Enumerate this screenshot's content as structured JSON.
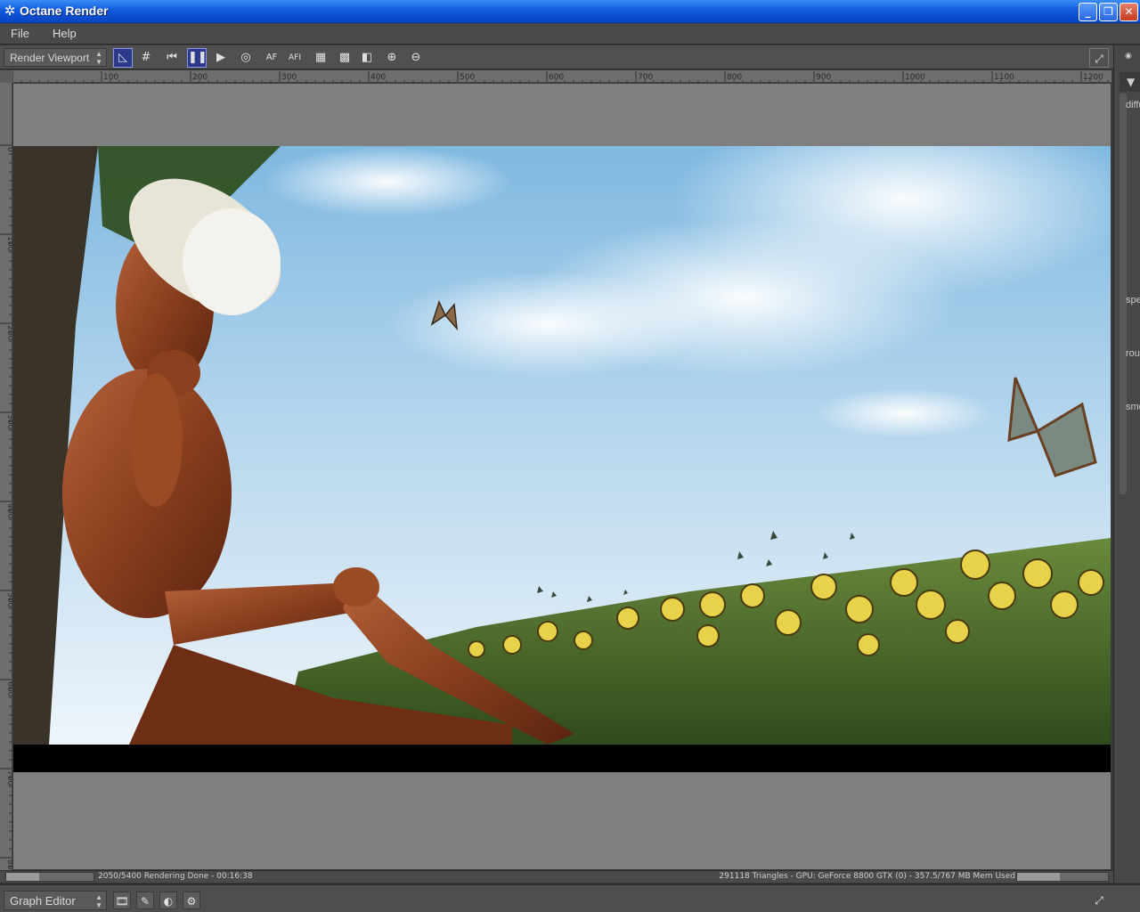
{
  "window": {
    "title": "Octane Render",
    "controls": {
      "minimize": "_",
      "maximize": "❐",
      "close": "✕"
    }
  },
  "menu": {
    "items": [
      "File",
      "Help"
    ]
  },
  "toolbar": {
    "viewport_select": "Render Viewport",
    "buttons": [
      {
        "name": "pick-focus-button",
        "glyph": "◺",
        "active": true
      },
      {
        "name": "grid-button",
        "glyph": "#",
        "active": false
      },
      {
        "name": "restart-render-button",
        "glyph": "⏮",
        "active": false
      },
      {
        "name": "pause-render-button",
        "glyph": "❚❚",
        "active": true
      },
      {
        "name": "play-render-button",
        "glyph": "▶",
        "active": false
      },
      {
        "name": "recenter-view-button",
        "glyph": "◎",
        "active": false
      },
      {
        "name": "auto-focus-button",
        "glyph": "AF",
        "active": false
      },
      {
        "name": "auto-focus-interactive-button",
        "glyph": "AFI",
        "active": false
      },
      {
        "name": "alpha-channel-button",
        "glyph": "▦",
        "active": false
      },
      {
        "name": "checker-background-button",
        "glyph": "▩",
        "active": false
      },
      {
        "name": "region-render-button",
        "glyph": "◧",
        "active": false
      },
      {
        "name": "zoom-in-button",
        "glyph": "⊕",
        "active": false
      },
      {
        "name": "zoom-out-button",
        "glyph": "⊖",
        "active": false
      }
    ],
    "fullscreen_glyph": "⤢"
  },
  "ruler": {
    "h_labels": [
      "100",
      "200",
      "300",
      "400",
      "500",
      "600",
      "700",
      "800",
      "900",
      "1000",
      "1100",
      "1200"
    ],
    "v_labels": [
      "0",
      "100",
      "200",
      "300",
      "400",
      "500",
      "600",
      "700",
      "800"
    ]
  },
  "status": {
    "render_progress": 0.38,
    "render_text": "2050/5400 Rendering Done - 00:16:38",
    "gpu_text": "291118 Triangles - GPU: GeForce 8800 GTX (0) - 357.5/767 MB Mem Used",
    "mem_fraction": 0.466
  },
  "graph_editor": {
    "select": "Graph Editor",
    "buttons": [
      "🎞",
      "✎",
      "◐",
      "⚙"
    ],
    "fullscreen_glyph": "⤢"
  },
  "right_panel": {
    "labels": [
      "diffuse",
      "specular",
      "roughness",
      "smooth"
    ]
  }
}
